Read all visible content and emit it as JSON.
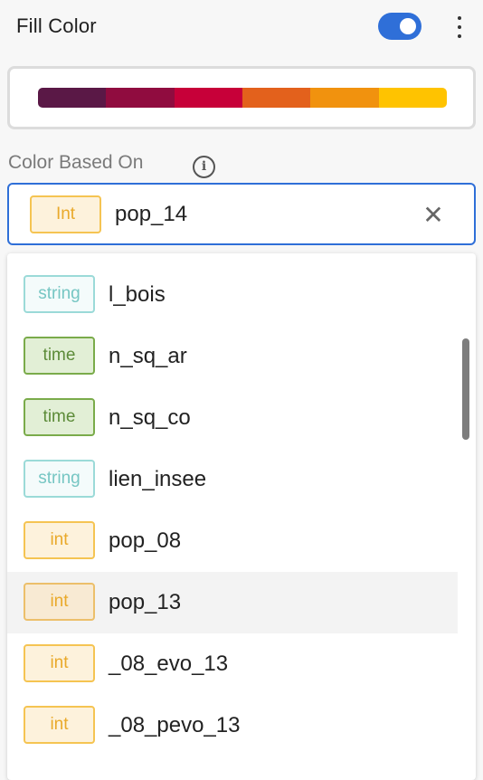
{
  "header": {
    "title": "Fill Color",
    "toggle_on": true
  },
  "palette": {
    "colors": [
      "#5a1846",
      "#900c3f",
      "#c70039",
      "#e3611c",
      "#f1920e",
      "#ffc300"
    ]
  },
  "color_based_on": {
    "label": "Color Based On",
    "selected": {
      "type": "Int",
      "value": "pop_14"
    }
  },
  "dropdown": {
    "options": [
      {
        "type": "string",
        "label": "l_bois"
      },
      {
        "type": "time",
        "label": "n_sq_ar"
      },
      {
        "type": "time",
        "label": "n_sq_co"
      },
      {
        "type": "string",
        "label": "lien_insee"
      },
      {
        "type": "int",
        "label": "pop_08"
      },
      {
        "type": "int",
        "label": "pop_13",
        "highlighted": true
      },
      {
        "type": "int",
        "label": "_08_evo_13"
      },
      {
        "type": "int",
        "label": "_08_pevo_13"
      }
    ]
  },
  "colors": {
    "accent": "#2f6fd8",
    "int_tag": "#f5c452",
    "time_tag": "#7aab4a",
    "string_tag": "#9bdad8"
  }
}
